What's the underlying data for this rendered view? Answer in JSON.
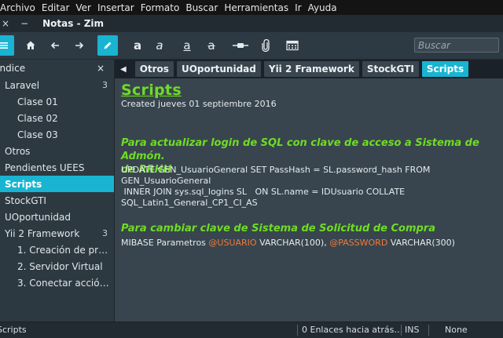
{
  "menubar": {
    "items": [
      "Archivo",
      "Editar",
      "Ver",
      "Insertar",
      "Formato",
      "Buscar",
      "Herramientas",
      "Ir",
      "Ayuda"
    ]
  },
  "titlebar": {
    "close_glyph": "×",
    "minimize_glyph": "−",
    "title": "Notas - Zim"
  },
  "toolbar": {
    "search_placeholder": "Buscar",
    "bold_label": "a",
    "italic_label": "a",
    "underline_label": "a",
    "strike_label": "a"
  },
  "sidebar": {
    "header": "Índice",
    "close_glyph": "×",
    "items": [
      {
        "label": "Laravel",
        "count": "3",
        "level": 0
      },
      {
        "label": "Clase 01",
        "count": "",
        "level": 1
      },
      {
        "label": "Clase 02",
        "count": "",
        "level": 1
      },
      {
        "label": "Clase 03",
        "count": "",
        "level": 1
      },
      {
        "label": "Otros",
        "count": "",
        "level": 0
      },
      {
        "label": "Pendientes UEES",
        "count": "",
        "level": 0
      },
      {
        "label": "Scripts",
        "count": "",
        "level": 0,
        "selected": true
      },
      {
        "label": "StockGTI",
        "count": "",
        "level": 0
      },
      {
        "label": "UOportunidad",
        "count": "",
        "level": 0
      },
      {
        "label": "Yii 2 Framework",
        "count": "3",
        "level": 0
      },
      {
        "label": "1. Creación de pr…",
        "count": "",
        "level": 1
      },
      {
        "label": "2. Servidor Virtual",
        "count": "",
        "level": 1
      },
      {
        "label": "3. Conectar acció…",
        "count": "",
        "level": 1
      }
    ]
  },
  "tabs": {
    "back_glyph": "◀",
    "items": [
      {
        "label": "Otros",
        "active": false
      },
      {
        "label": "UOportunidad",
        "active": false
      },
      {
        "label": "Yii 2 Framework",
        "active": false
      },
      {
        "label": "StockGTI",
        "active": false
      },
      {
        "label": "Scripts",
        "active": true
      }
    ]
  },
  "page": {
    "title": "Scripts",
    "created": "Created jueves 01 septiembre 2016",
    "heading1_line1": "Para actualizar login de SQL con clave de acceso a Sistema de Admón.",
    "heading1_line2": "de RRHH",
    "sql1_line1": "UPDATE GEN_UsuarioGeneral SET PassHash = SL.password_hash FROM",
    "sql1_line2": "GEN_UsuarioGeneral",
    "sql1_line3": " INNER JOIN sys.sql_logins SL   ON SL.name = IDUsuario COLLATE",
    "sql1_line4": "SQL_Latin1_General_CP1_CI_AS",
    "heading2": "Para cambiar clave de Sistema de Solicitud de Compra",
    "sql2_prefix": "MIBASE Parametros ",
    "sql2_var1": "@USUARIO",
    "sql2_mid": " VARCHAR(100), ",
    "sql2_var2": "@PASSWORD",
    "sql2_suffix": " VARCHAR(300)"
  },
  "statusbar": {
    "page": "Scripts",
    "backlinks": "0 Enlaces hacia atrás…",
    "mode": "INS",
    "style": "None"
  },
  "colors": {
    "accent": "#19b4d1",
    "heading_green": "#6fdc24",
    "variable_orange": "#f07a3a"
  }
}
